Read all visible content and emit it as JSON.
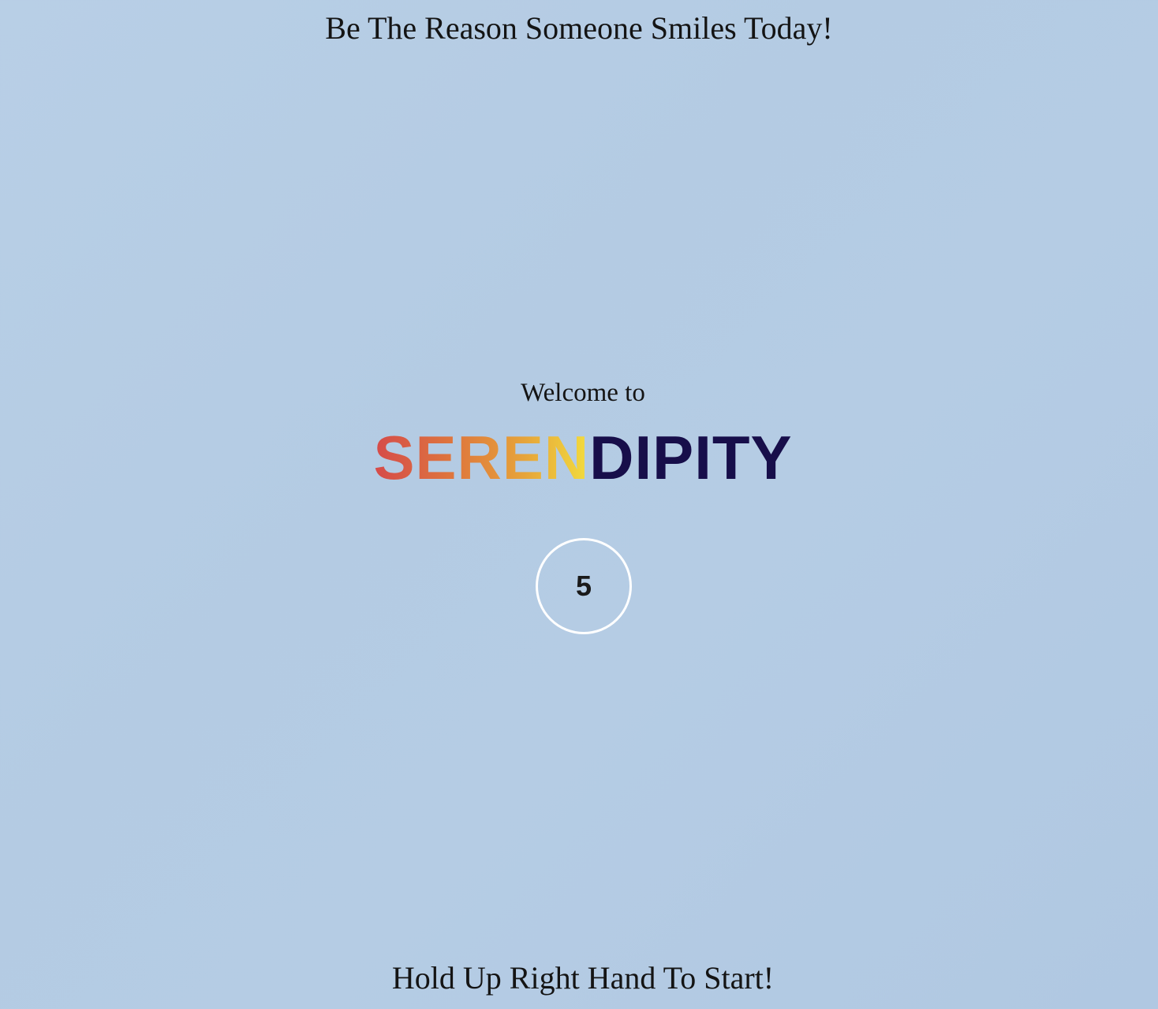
{
  "header": {
    "tagline": "Be The Reason Someone Smiles Today!"
  },
  "hero": {
    "welcome_text": "Welcome to",
    "brand_part_colored": "SEREN",
    "brand_part_dark": "DIPITY",
    "brand_gradient_colors": [
      "#d54a4a",
      "#df7a3c",
      "#e6a43a",
      "#f2dc3e"
    ],
    "brand_dark_color": "#170e4a"
  },
  "countdown": {
    "value": "5"
  },
  "footer": {
    "instruction": "Hold Up Right Hand To Start!"
  },
  "colors": {
    "background": "#b5cce4",
    "countdown_ring": "#ffffff"
  }
}
